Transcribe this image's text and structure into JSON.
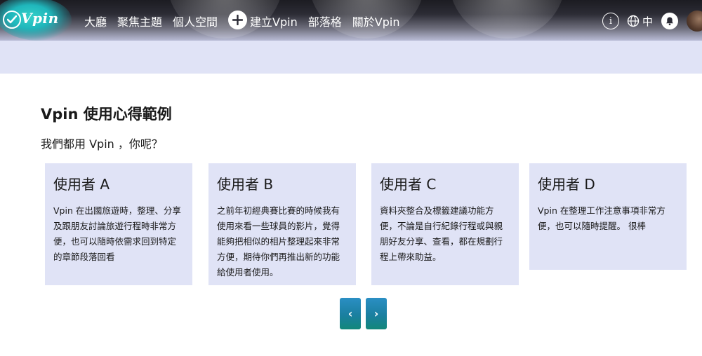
{
  "header": {
    "logo_text": "Vpin",
    "nav": [
      {
        "label": "大廳"
      },
      {
        "label": "聚焦主題"
      },
      {
        "label": "個人空間"
      },
      {
        "label": "建立Vpin"
      },
      {
        "label": "部落格"
      },
      {
        "label": "關於Vpin"
      }
    ],
    "info_glyph": "i",
    "language": "中"
  },
  "section": {
    "title": "Vpin 使用心得範例",
    "subtitle": "我們都用 Vpin ，你呢？"
  },
  "cards": [
    {
      "title": "使用者 A",
      "text": "Vpin 在出國旅遊時，整理、分享及跟朋友討論旅遊行程時非常方便，也可以隨時依需求回到特定的章節段落回看"
    },
    {
      "title": "使用者 B",
      "text": "之前年初經典賽比賽的時候我有使用來看一些球員的影片，覺得能夠把相似的相片整理起來非常方便，期待你們再推出新的功能給使用者使用。"
    },
    {
      "title": "使用者 C",
      "text": "資料夾整合及標籤建議功能方便，不論是自行紀錄行程或與親朋好友分享、查看，都在規劃行程上帶來助益。"
    },
    {
      "title": "使用者 D",
      "text": "Vpin 在整理工作注意事項非常方便，也可以隨時提醒。 很棒"
    }
  ],
  "pager": {
    "prev_glyph": "‹",
    "next_glyph": "›"
  },
  "colors": {
    "card_bg": "#e0e3f6",
    "accent": "#1a7fa0"
  },
  "icons": [
    "check-circle-icon",
    "plus-circle-icon",
    "info-icon",
    "globe-icon",
    "bell-icon",
    "chevron-left-icon",
    "chevron-right-icon"
  ]
}
